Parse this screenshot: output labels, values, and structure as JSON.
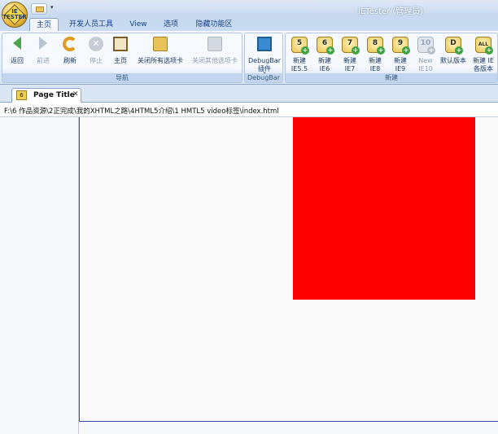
{
  "window": {
    "title": "IETester (管理员)",
    "orb_label": "IE TESTER"
  },
  "ribbon_tabs": [
    "主页",
    "开发人员工具",
    "View",
    "选项",
    "隐藏功能区"
  ],
  "groups": {
    "nav": {
      "caption": "导航",
      "back": "返回",
      "forward": "前进",
      "refresh": "刷新",
      "stop": "停止",
      "home": "主页",
      "close_all": "关闭所有选项卡",
      "close_others": "关闭其他选项卡",
      "dropdown_caret": "▾",
      "stop_glyph": "✕"
    },
    "debug": {
      "caption": "DebugBar",
      "plugin": "DebugBar 插件",
      "dropdown_caret": "▾"
    },
    "new": {
      "caption": "新建",
      "items": [
        {
          "num": "5",
          "label": "新建 IE5.5"
        },
        {
          "num": "6",
          "label": "新建 IE6"
        },
        {
          "num": "7",
          "label": "新建 IE7"
        },
        {
          "num": "8",
          "label": "新建 IE8"
        },
        {
          "num": "9",
          "label": "新建 IE9"
        },
        {
          "num": "10",
          "label": "New IE10"
        },
        {
          "num": "D",
          "label": "默认版本"
        },
        {
          "num": "ALL",
          "label": "新建 IE 各版本"
        }
      ],
      "plus_glyph": "+"
    }
  },
  "document_tab": {
    "icon_num": "6",
    "title": "Page Title",
    "close": "✕"
  },
  "address": "F:\\6 作品资源\\2正完成\\我的XHTML之路\\4HTML5介绍\\1 HMTL5 video标签\\index.html",
  "colors": {
    "red_box": "#ff0000",
    "frame_border": "#3e4fa8"
  }
}
